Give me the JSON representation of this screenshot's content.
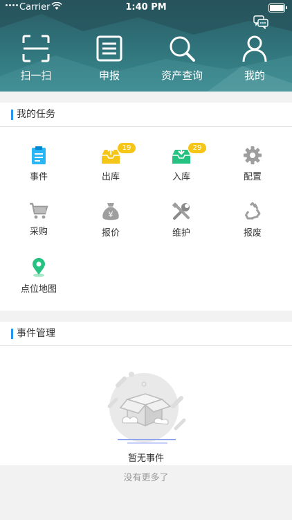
{
  "status_bar": {
    "carrier": "Carrier",
    "time": "1:40 PM"
  },
  "header": {
    "actions": [
      {
        "label": "扫一扫",
        "icon": "scan-icon"
      },
      {
        "label": "申报",
        "icon": "report-icon"
      },
      {
        "label": "资产查询",
        "icon": "search-icon"
      },
      {
        "label": "我的",
        "icon": "user-icon"
      }
    ],
    "message_icon": "chat-icon"
  },
  "tasks": {
    "title": "我的任务",
    "items": [
      {
        "label": "事件",
        "icon": "event-icon",
        "color": "#29b6f6"
      },
      {
        "label": "出库",
        "icon": "outbound-icon",
        "badge": "19",
        "color": "#f5c518"
      },
      {
        "label": "入库",
        "icon": "inbound-icon",
        "badge": "29",
        "color": "#26c281"
      },
      {
        "label": "配置",
        "icon": "gear-icon",
        "color": "#9e9e9e"
      },
      {
        "label": "采购",
        "icon": "cart-icon",
        "color": "#9e9e9e"
      },
      {
        "label": "报价",
        "icon": "money-bag-icon",
        "color": "#9e9e9e"
      },
      {
        "label": "维护",
        "icon": "tools-icon",
        "color": "#9e9e9e"
      },
      {
        "label": "报废",
        "icon": "recycle-icon",
        "color": "#9e9e9e"
      },
      {
        "label": "点位地图",
        "icon": "location-pin-icon",
        "color": "#26c281"
      }
    ]
  },
  "events": {
    "title": "事件管理",
    "empty_text": "暂无事件"
  },
  "footer": {
    "text": "没有更多了"
  },
  "colors": {
    "accent": "#2196f3",
    "badge": "#f5c518",
    "header": "#2f7078"
  }
}
